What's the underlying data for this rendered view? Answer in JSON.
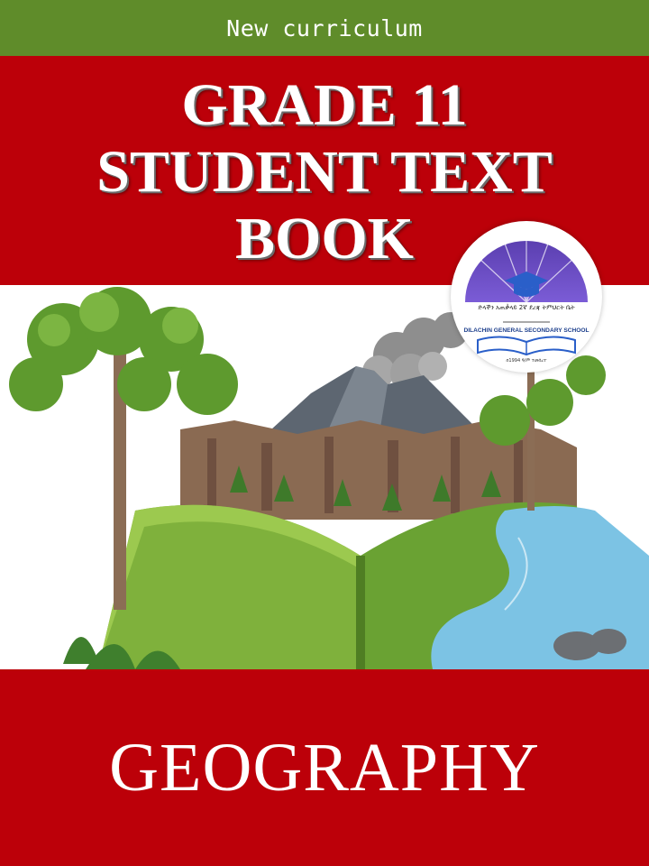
{
  "header": {
    "banner_text": "New curriculum"
  },
  "title": {
    "line1": "GRADE 11",
    "line2": "STUDENT TEXT",
    "line3": "BOOK"
  },
  "subject": "GEOGRAPHY",
  "logo": {
    "amharic_name": "ድላችን አጠቃላይ 2ኛ ደረጃ ትምህርት ቤት",
    "school_name": "DILACHIN GENERAL SECONDARY SCHOOL",
    "established": "በ1994 ዓ/ም ተመሰረተ"
  },
  "colors": {
    "top_band": "#5f8c2a",
    "title_band": "#bc0009",
    "bottom_band": "#bc0009",
    "text": "#ffffff"
  },
  "illustration": {
    "icon": "open-book-landscape-illustration"
  }
}
